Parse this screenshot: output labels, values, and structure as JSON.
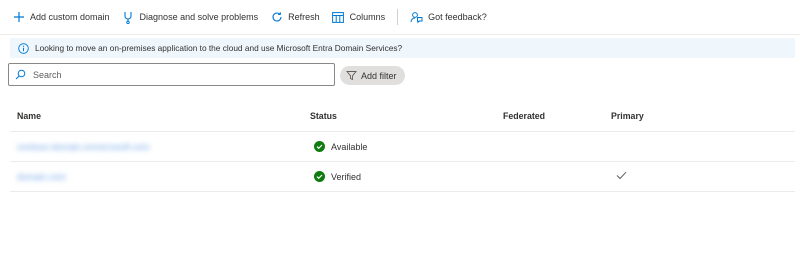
{
  "toolbar": {
    "add_domain": "Add custom domain",
    "diagnose": "Diagnose and solve problems",
    "refresh": "Refresh",
    "columns": "Columns",
    "feedback": "Got feedback?"
  },
  "banner": {
    "text": "Looking to move an on-premises application to the cloud and use Microsoft Entra Domain Services?"
  },
  "search": {
    "placeholder": "Search",
    "value": ""
  },
  "filter": {
    "label": "Add filter"
  },
  "table": {
    "columns": [
      "Name",
      "Status",
      "Federated",
      "Primary"
    ],
    "rows": [
      {
        "name": "contoso-domain.onmicrosoft.com",
        "status": "Available",
        "federated": "",
        "primary": false
      },
      {
        "name": "domain.com",
        "status": "Verified",
        "federated": "",
        "primary": true
      }
    ]
  },
  "colors": {
    "accent": "#0078d4",
    "success": "#107c10",
    "banner_bg": "#eff6fc"
  },
  "icons": {
    "add": "plus-icon",
    "diagnose": "stethoscope-icon",
    "refresh": "refresh-icon",
    "columns": "columns-icon",
    "feedback": "feedback-icon",
    "info": "info-icon",
    "search": "search-icon",
    "filter": "filter-icon",
    "status_ok": "check-circle-icon",
    "primary": "checkmark-icon"
  }
}
